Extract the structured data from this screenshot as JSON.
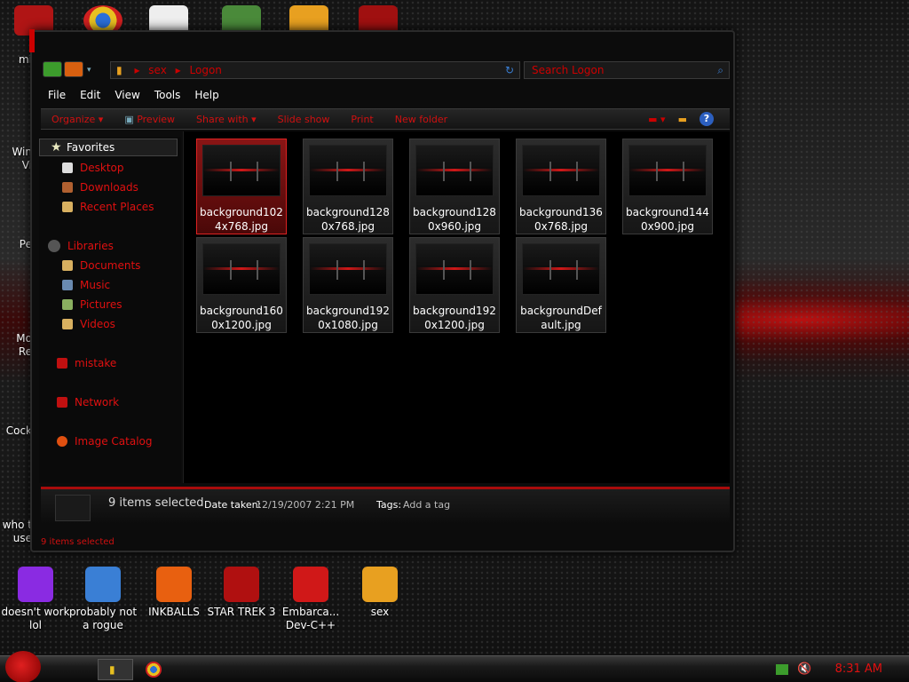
{
  "desktop": {
    "left_clipped": [
      "mi",
      "Win\nVi",
      "Pe",
      "Mo\nRe",
      "Cock",
      "who t\nuse"
    ],
    "bottom_icons": [
      {
        "label": "doesn't work lol",
        "color": "#8a2be2"
      },
      {
        "label": "probably not a rogue",
        "color": "#3a7fd5"
      },
      {
        "label": "INKBALLS",
        "color": "#e86010"
      },
      {
        "label": "STAR TREK 3",
        "color": "#b01010"
      },
      {
        "label": "Embarca... Dev-C++",
        "color": "#d01818"
      },
      {
        "label": "sex",
        "color": "#e8a020"
      }
    ]
  },
  "address": {
    "crumbs": [
      "sex",
      "Logon"
    ],
    "search_placeholder": "Search Logon"
  },
  "menu": [
    "File",
    "Edit",
    "View",
    "Tools",
    "Help"
  ],
  "toolbar": [
    "Organize ▾",
    "Preview",
    "Share with ▾",
    "Slide show",
    "Print",
    "New folder"
  ],
  "help_label": "?",
  "nav": {
    "favorites_label": "Favorites",
    "favorites": [
      "Desktop",
      "Downloads",
      "Recent Places"
    ],
    "libraries_label": "Libraries",
    "libraries": [
      "Documents",
      "Music",
      "Pictures",
      "Videos"
    ],
    "other": [
      "mistake",
      "Network",
      "Image Catalog"
    ]
  },
  "files": [
    "background1024x768.jpg",
    "background1280x768.jpg",
    "background1280x960.jpg",
    "background1360x768.jpg",
    "background1440x900.jpg",
    "background1600x1200.jpg",
    "background1920x1080.jpg",
    "background1920x1200.jpg",
    "backgroundDefault.jpg"
  ],
  "details": {
    "count": "9 items selected",
    "date_label": "Date taken:",
    "date_value": "12/19/2007 2:21 PM",
    "tags_label": "Tags:",
    "tags_value": "Add a tag"
  },
  "status": "9 items selected",
  "clock": "8:31 AM"
}
